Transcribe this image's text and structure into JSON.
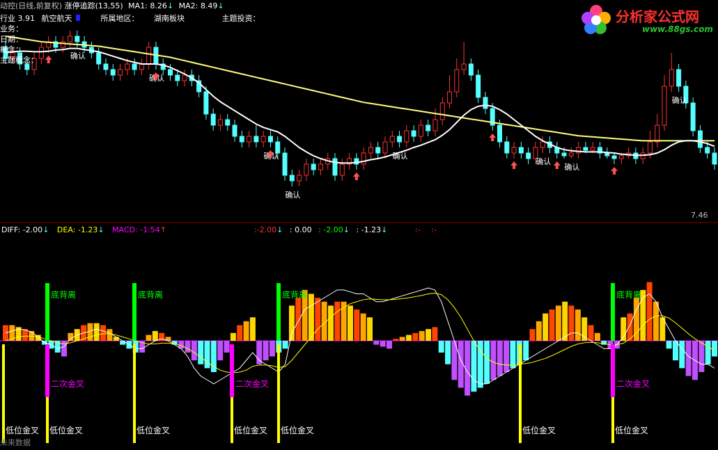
{
  "header": {
    "title": "动控(日线,前复权)",
    "indicator": "涨停追踪(13,55)",
    "ma1_label": "MA1: 8.26",
    "ma2_label": "MA2: 8.49",
    "arrow_down": "↓",
    "industry_prefix": "行业 3.91",
    "industry_value": "航空航天",
    "region_label": "所属地区：",
    "region_value": "湖南板块",
    "theme_label": "主题投资：",
    "left_labels": [
      "业务：",
      "日期：",
      "概念：",
      "主题概念：",
      "行业："
    ]
  },
  "logo": {
    "text": "分析家公式网",
    "url_text": "www.88gs.com"
  },
  "price_axis_label": "7.46",
  "macd_header": {
    "diff": "DIFF: -2.00",
    "dea": "DEA: -1.23",
    "macd": "MACD: -1.54",
    "extra": [
      ":-2.00",
      ": 0.00",
      ": -2.00",
      ": -1.23",
      ":-",
      ":-"
    ],
    "arrow_down": "↓",
    "arrow_up": "↑"
  },
  "labels": {
    "confirm": "确认",
    "bottom_divergence": "底背离",
    "second_golden_cross": "二次金叉",
    "low_golden_cross": "低位金叉",
    "future_data": "未来数据"
  },
  "colors": {
    "up": "#ff3232",
    "down": "#54ffff",
    "ma_white": "#ffffff",
    "ma_yellow": "#ffff80",
    "macd_red": "#ff4500",
    "macd_orange": "#ffa500",
    "macd_yellow": "#ffd700",
    "macd_blue": "#54ffff",
    "macd_purple": "#c050ff",
    "green": "#00ff00",
    "magenta": "#ff00ff"
  },
  "chart_data": {
    "type": "candlestick",
    "ylim": [
      7.0,
      10.5
    ],
    "candles": [
      [
        9.9,
        9.7,
        10.0,
        9.6
      ],
      [
        9.7,
        9.8,
        9.9,
        9.6
      ],
      [
        9.8,
        9.6,
        9.9,
        9.5
      ],
      [
        9.6,
        9.5,
        9.7,
        9.4
      ],
      [
        9.5,
        9.7,
        9.8,
        9.4
      ],
      [
        9.7,
        9.9,
        10.0,
        9.6
      ],
      [
        9.9,
        10.0,
        10.1,
        9.8
      ],
      [
        10.0,
        9.9,
        10.1,
        9.8
      ],
      [
        9.9,
        10.0,
        10.1,
        9.8
      ],
      [
        10.0,
        10.1,
        10.2,
        9.9
      ],
      [
        10.1,
        10.0,
        10.2,
        9.9
      ],
      [
        10.0,
        9.9,
        10.1,
        9.8
      ],
      [
        9.9,
        9.8,
        10.0,
        9.7
      ],
      [
        9.8,
        9.6,
        9.9,
        9.5
      ],
      [
        9.6,
        9.5,
        9.7,
        9.4
      ],
      [
        9.5,
        9.4,
        9.6,
        9.3
      ],
      [
        9.4,
        9.5,
        9.6,
        9.3
      ],
      [
        9.5,
        9.6,
        9.7,
        9.4
      ],
      [
        9.6,
        9.5,
        9.7,
        9.4
      ],
      [
        9.5,
        9.6,
        9.7,
        9.4
      ],
      [
        9.6,
        9.9,
        10.0,
        9.5
      ],
      [
        9.9,
        9.6,
        10.0,
        9.5
      ],
      [
        9.6,
        9.5,
        9.7,
        9.4
      ],
      [
        9.5,
        9.4,
        9.6,
        9.3
      ],
      [
        9.4,
        9.3,
        9.5,
        9.2
      ],
      [
        9.3,
        9.4,
        9.5,
        9.2
      ],
      [
        9.4,
        9.3,
        9.5,
        9.2
      ],
      [
        9.3,
        9.1,
        9.4,
        9.0
      ],
      [
        9.1,
        8.7,
        9.2,
        8.6
      ],
      [
        8.7,
        8.5,
        8.8,
        8.4
      ],
      [
        8.5,
        8.6,
        8.7,
        8.4
      ],
      [
        8.6,
        8.5,
        8.7,
        8.4
      ],
      [
        8.5,
        8.3,
        8.6,
        8.2
      ],
      [
        8.3,
        8.2,
        8.4,
        8.1
      ],
      [
        8.2,
        8.3,
        8.4,
        8.1
      ],
      [
        8.3,
        8.2,
        8.5,
        8.1
      ],
      [
        8.2,
        8.3,
        8.4,
        8.1
      ],
      [
        8.3,
        8.2,
        8.4,
        8.1
      ],
      [
        8.2,
        8.0,
        8.3,
        7.9
      ],
      [
        8.0,
        7.6,
        8.1,
        7.5
      ],
      [
        7.6,
        7.5,
        7.7,
        7.4
      ],
      [
        7.5,
        7.6,
        7.7,
        7.4
      ],
      [
        7.6,
        7.8,
        7.9,
        7.5
      ],
      [
        7.8,
        7.7,
        7.9,
        7.6
      ],
      [
        7.7,
        7.8,
        7.9,
        7.6
      ],
      [
        7.8,
        7.9,
        8.0,
        7.7
      ],
      [
        7.9,
        7.6,
        8.0,
        7.5
      ],
      [
        7.6,
        7.8,
        7.9,
        7.5
      ],
      [
        7.8,
        7.9,
        8.0,
        7.7
      ],
      [
        7.9,
        7.8,
        8.0,
        7.7
      ],
      [
        7.8,
        8.0,
        8.1,
        7.7
      ],
      [
        8.0,
        8.1,
        8.2,
        7.9
      ],
      [
        8.1,
        8.0,
        8.2,
        7.9
      ],
      [
        8.0,
        8.2,
        8.3,
        7.9
      ],
      [
        8.2,
        8.3,
        8.4,
        8.1
      ],
      [
        8.3,
        8.2,
        8.4,
        8.1
      ],
      [
        8.2,
        8.4,
        8.5,
        8.1
      ],
      [
        8.4,
        8.3,
        8.5,
        8.2
      ],
      [
        8.3,
        8.5,
        8.6,
        8.2
      ],
      [
        8.5,
        8.4,
        8.6,
        8.3
      ],
      [
        8.4,
        8.6,
        8.8,
        8.3
      ],
      [
        8.6,
        8.9,
        9.0,
        8.5
      ],
      [
        8.9,
        9.1,
        9.4,
        8.8
      ],
      [
        9.1,
        9.5,
        9.7,
        9.0
      ],
      [
        9.5,
        9.6,
        10.0,
        9.4
      ],
      [
        9.6,
        9.4,
        9.7,
        9.3
      ],
      [
        9.4,
        9.0,
        9.5,
        8.9
      ],
      [
        9.0,
        8.8,
        9.1,
        8.7
      ],
      [
        8.8,
        8.5,
        8.9,
        8.4
      ],
      [
        8.5,
        8.2,
        8.6,
        8.1
      ],
      [
        8.2,
        8.0,
        8.3,
        7.9
      ],
      [
        8.0,
        8.1,
        8.2,
        7.9
      ],
      [
        8.1,
        8.0,
        8.2,
        7.9
      ],
      [
        8.0,
        7.9,
        8.1,
        7.8
      ],
      [
        7.9,
        8.1,
        8.2,
        7.8
      ],
      [
        8.1,
        8.2,
        8.3,
        8.0
      ],
      [
        8.2,
        8.1,
        8.3,
        8.0
      ],
      [
        8.1,
        8.0,
        8.2,
        7.9
      ],
      [
        8.0,
        7.95,
        8.1,
        7.9
      ],
      [
        7.95,
        8.0,
        8.1,
        7.9
      ],
      [
        8.0,
        8.1,
        8.2,
        7.9
      ],
      [
        8.1,
        8.05,
        8.2,
        8.0
      ],
      [
        8.05,
        8.1,
        8.2,
        8.0
      ],
      [
        8.1,
        8.0,
        8.2,
        7.9
      ],
      [
        8.0,
        7.95,
        8.1,
        7.9
      ],
      [
        7.95,
        7.9,
        8.0,
        7.8
      ],
      [
        7.9,
        7.95,
        8.0,
        7.8
      ],
      [
        7.95,
        8.0,
        8.1,
        7.9
      ],
      [
        8.0,
        7.9,
        8.1,
        7.8
      ],
      [
        7.9,
        8.0,
        8.1,
        7.8
      ],
      [
        8.0,
        8.2,
        8.4,
        7.9
      ],
      [
        8.2,
        8.5,
        8.7,
        8.1
      ],
      [
        8.5,
        9.2,
        9.4,
        8.4
      ],
      [
        9.2,
        9.5,
        9.8,
        9.1
      ],
      [
        9.5,
        9.2,
        9.6,
        9.1
      ],
      [
        9.2,
        8.9,
        9.3,
        8.8
      ],
      [
        8.9,
        8.4,
        9.0,
        8.3
      ],
      [
        8.4,
        8.1,
        8.5,
        8.0
      ],
      [
        8.1,
        8.0,
        8.2,
        7.9
      ],
      [
        8.0,
        7.8,
        8.1,
        7.7
      ]
    ],
    "ma_white": [
      9.8,
      9.82,
      9.83,
      9.83,
      9.82,
      9.82,
      9.83,
      9.85,
      9.86,
      9.88,
      9.88,
      9.86,
      9.84,
      9.82,
      9.78,
      9.74,
      9.7,
      9.66,
      9.63,
      9.6,
      9.6,
      9.6,
      9.58,
      9.54,
      9.48,
      9.42,
      9.35,
      9.26,
      9.14,
      9.02,
      8.92,
      8.84,
      8.76,
      8.68,
      8.6,
      8.52,
      8.46,
      8.42,
      8.38,
      8.3,
      8.2,
      8.1,
      8.02,
      7.95,
      7.9,
      7.86,
      7.83,
      7.82,
      7.82,
      7.83,
      7.85,
      7.88,
      7.9,
      7.93,
      7.97,
      8.01,
      8.05,
      8.1,
      8.14,
      8.19,
      8.24,
      8.32,
      8.42,
      8.55,
      8.68,
      8.78,
      8.84,
      8.86,
      8.84,
      8.78,
      8.7,
      8.6,
      8.5,
      8.4,
      8.3,
      8.22,
      8.16,
      8.1,
      8.06,
      8.04,
      8.03,
      8.02,
      8.02,
      8.02,
      8.01,
      8.0,
      7.98,
      7.97,
      7.96,
      7.96,
      7.97,
      8.0,
      8.06,
      8.14,
      8.2,
      8.22,
      8.22,
      8.2,
      8.17,
      8.12
    ],
    "ma_yellow": [
      10.1,
      10.08,
      10.06,
      10.04,
      10.02,
      10.0,
      9.99,
      9.98,
      9.97,
      9.96,
      9.95,
      9.94,
      9.93,
      9.92,
      9.9,
      9.88,
      9.86,
      9.84,
      9.82,
      9.8,
      9.78,
      9.76,
      9.74,
      9.72,
      9.69,
      9.66,
      9.63,
      9.6,
      9.57,
      9.54,
      9.51,
      9.48,
      9.45,
      9.42,
      9.39,
      9.36,
      9.33,
      9.3,
      9.27,
      9.24,
      9.21,
      9.18,
      9.15,
      9.12,
      9.09,
      9.06,
      9.03,
      9.0,
      8.97,
      8.94,
      8.91,
      8.89,
      8.87,
      8.85,
      8.83,
      8.81,
      8.79,
      8.77,
      8.75,
      8.73,
      8.71,
      8.69,
      8.67,
      8.65,
      8.63,
      8.61,
      8.59,
      8.57,
      8.55,
      8.53,
      8.51,
      8.49,
      8.47,
      8.45,
      8.43,
      8.41,
      8.39,
      8.37,
      8.35,
      8.33,
      8.31,
      8.3,
      8.29,
      8.28,
      8.27,
      8.26,
      8.25,
      8.24,
      8.23,
      8.22,
      8.22,
      8.22,
      8.22,
      8.22,
      8.22,
      8.22,
      8.22,
      8.22,
      8.22,
      8.22
    ],
    "macd_ylim": [
      -1.6,
      1.6
    ],
    "macd": [
      0.4,
      0.4,
      0.35,
      0.3,
      0.25,
      0.15,
      -0.1,
      -0.2,
      -0.3,
      -0.4,
      0.2,
      0.3,
      0.4,
      0.45,
      0.45,
      0.4,
      0.3,
      0.1,
      -0.1,
      -0.2,
      -0.3,
      -0.3,
      0.15,
      0.25,
      0.2,
      0.1,
      -0.1,
      -0.2,
      -0.3,
      -0.5,
      -0.6,
      -0.7,
      -0.8,
      -0.5,
      -0.3,
      0.2,
      0.4,
      0.5,
      0.6,
      -0.6,
      -0.5,
      -0.4,
      -0.3,
      -0.2,
      0.9,
      1.1,
      1.3,
      1.2,
      1.1,
      1.0,
      0.9,
      1.0,
      1.0,
      0.9,
      0.8,
      0.7,
      0.6,
      -0.1,
      -0.15,
      -0.2,
      0.05,
      0.1,
      0.15,
      0.2,
      0.25,
      0.3,
      0.35,
      -0.3,
      -0.6,
      -1.0,
      -1.2,
      -1.4,
      -1.3,
      -1.2,
      -1.1,
      -1.0,
      -0.9,
      -0.8,
      -0.7,
      -0.6,
      -0.5,
      0.3,
      0.5,
      0.7,
      0.8,
      0.9,
      1.0,
      0.9,
      0.8,
      0.6,
      0.4,
      0.2,
      -0.1,
      -0.2,
      -0.2,
      0.6,
      0.7,
      1.1,
      1.3,
      1.5,
      1.0,
      0.6,
      -0.2,
      -0.5,
      -0.7,
      -0.9,
      -1.0,
      -0.8,
      -0.6,
      -0.4
    ],
    "diff": [
      0.2,
      0.25,
      0.3,
      0.28,
      0.22,
      0.1,
      -0.05,
      -0.1,
      -0.2,
      -0.15,
      0.05,
      0.15,
      0.2,
      0.25,
      0.3,
      0.25,
      0.2,
      0.1,
      0.0,
      -0.1,
      -0.2,
      -0.2,
      -0.1,
      0.0,
      0.05,
      0.0,
      -0.1,
      -0.2,
      -0.4,
      -0.7,
      -0.9,
      -1.0,
      -1.1,
      -1.0,
      -0.9,
      -0.8,
      -0.7,
      -0.5,
      -0.3,
      -0.5,
      -0.6,
      -0.7,
      -0.8,
      -0.6,
      0.2,
      0.5,
      0.8,
      0.9,
      1.0,
      1.1,
      1.2,
      1.3,
      1.3,
      1.25,
      1.2,
      1.2,
      1.1,
      1.0,
      1.0,
      1.05,
      1.1,
      1.15,
      1.2,
      1.25,
      1.3,
      1.35,
      1.3,
      1.0,
      0.5,
      0.0,
      -0.5,
      -0.8,
      -1.0,
      -1.1,
      -1.1,
      -1.0,
      -0.9,
      -0.8,
      -0.7,
      -0.6,
      -0.5,
      -0.4,
      -0.3,
      -0.2,
      -0.1,
      0.0,
      0.1,
      0.2,
      0.2,
      0.1,
      0.0,
      -0.1,
      -0.2,
      -0.2,
      -0.1,
      0.1,
      0.4,
      0.8,
      1.1,
      1.2,
      1.0,
      0.6,
      0.3,
      0.0,
      -0.2,
      -0.4,
      -0.5,
      -0.6,
      -0.6,
      -0.7
    ],
    "dea": [
      0.0,
      0.05,
      0.1,
      0.12,
      0.12,
      0.1,
      0.05,
      0.0,
      -0.05,
      -0.08,
      -0.05,
      0.0,
      0.05,
      0.1,
      0.15,
      0.18,
      0.18,
      0.15,
      0.1,
      0.05,
      0.0,
      -0.05,
      -0.08,
      -0.08,
      -0.06,
      -0.06,
      -0.08,
      -0.12,
      -0.2,
      -0.3,
      -0.42,
      -0.55,
      -0.66,
      -0.75,
      -0.8,
      -0.82,
      -0.8,
      -0.75,
      -0.65,
      -0.62,
      -0.62,
      -0.64,
      -0.68,
      -0.66,
      -0.5,
      -0.3,
      -0.1,
      0.1,
      0.3,
      0.45,
      0.6,
      0.75,
      0.85,
      0.95,
      1.0,
      1.05,
      1.07,
      1.06,
      1.05,
      1.05,
      1.06,
      1.08,
      1.1,
      1.13,
      1.16,
      1.2,
      1.22,
      1.18,
      1.05,
      0.85,
      0.6,
      0.3,
      0.0,
      -0.25,
      -0.45,
      -0.55,
      -0.6,
      -0.62,
      -0.62,
      -0.6,
      -0.58,
      -0.55,
      -0.5,
      -0.45,
      -0.38,
      -0.3,
      -0.22,
      -0.14,
      -0.08,
      -0.05,
      -0.04,
      -0.05,
      -0.08,
      -0.1,
      -0.1,
      -0.06,
      0.05,
      0.2,
      0.4,
      0.55,
      0.64,
      0.64,
      0.58,
      0.46,
      0.32,
      0.18,
      0.05,
      -0.05,
      -0.15,
      -0.25
    ],
    "confirm_idx": [
      10,
      21,
      37,
      40,
      55,
      75,
      79,
      94
    ],
    "up_arrow_idx": [
      6,
      21,
      37,
      49,
      68,
      71,
      77,
      85
    ],
    "divergence_x": [
      68,
      193,
      400,
      880
    ],
    "second_cross_x": [
      68,
      333,
      880
    ],
    "low_cross_x": [
      5,
      68,
      193,
      333,
      400,
      747,
      880
    ]
  }
}
